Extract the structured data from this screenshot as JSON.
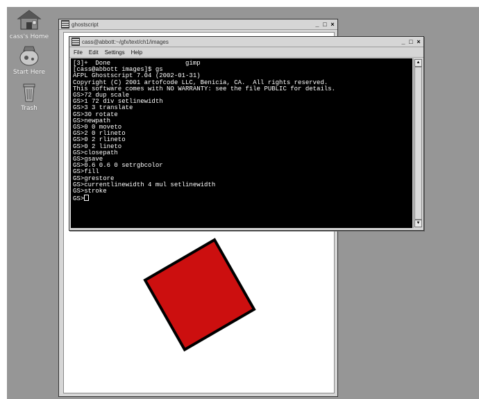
{
  "desktop": {
    "icons": [
      {
        "label": "cass's Home",
        "icon": "home-icon"
      },
      {
        "label": "Start Here",
        "icon": "start-here-icon"
      },
      {
        "label": "Trash",
        "icon": "trash-icon"
      }
    ]
  },
  "gs_window": {
    "title": "ghostscript",
    "controls": [
      "_",
      "□",
      "×"
    ]
  },
  "term_window": {
    "title": "cass@abbott:~/gfx/text/ch1/images",
    "menus": [
      "File",
      "Edit",
      "Settings",
      "Help"
    ],
    "lines": [
      "[3]+  Done                    gimp",
      "[cass@abbott images]$ gs",
      "AFPL Ghostscript 7.04 (2002-01-31)",
      "Copyright (C) 2001 artofcode LLC, Benicia, CA.  All rights reserved.",
      "This software comes with NO WARRANTY: see the file PUBLIC for details.",
      "GS>72 dup scale",
      "GS>1 72 div setlinewidth",
      "GS>3 3 translate",
      "GS>30 rotate",
      "GS>newpath",
      "GS>0 0 moveto",
      "GS>2 0 rlineto",
      "GS>0 2 rlineto",
      "GS>0 2 lineto",
      "GS>closepath",
      "GS>gsave",
      "GS>0.6 0.6 0 setrgbcolor",
      "GS>fill",
      "GS>grestore",
      "GS>currentlinewidth 4 mul setlinewidth",
      "GS>stroke"
    ],
    "prompt": "GS>"
  },
  "colors": {
    "square_fill": "#cc0f0f",
    "square_stroke": "#000000",
    "desktop_bg": "#969696"
  }
}
